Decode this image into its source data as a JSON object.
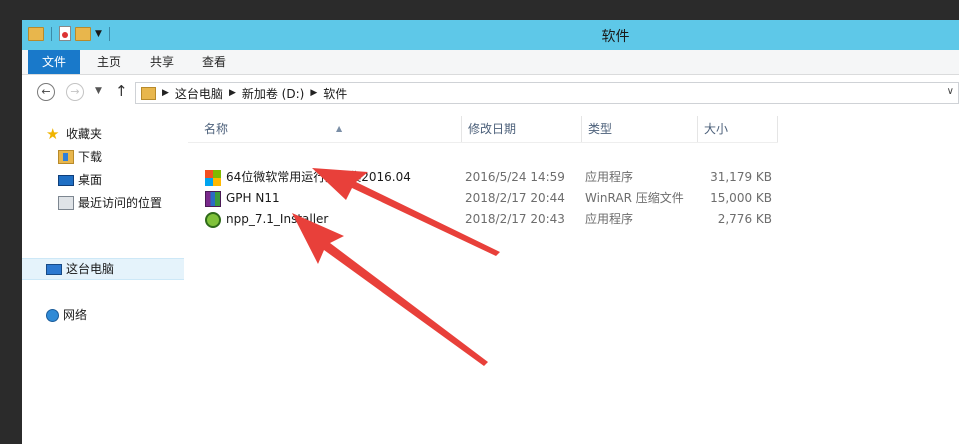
{
  "window": {
    "title": "软件"
  },
  "ribbon": {
    "tabs": [
      {
        "label": "文件"
      },
      {
        "label": "主页"
      },
      {
        "label": "共享"
      },
      {
        "label": "查看"
      }
    ]
  },
  "address": {
    "crumbs": [
      "这台电脑",
      "新加卷 (D:)",
      "软件"
    ]
  },
  "nav_pane": {
    "favorites": "收藏夹",
    "downloads": "下载",
    "desktop": "桌面",
    "recent": "最近访问的位置",
    "this_pc": "这台电脑",
    "network": "网络"
  },
  "columns": {
    "name": "名称",
    "date": "修改日期",
    "type": "类型",
    "size": "大小"
  },
  "files": [
    {
      "name": "64位微软常用运行库合集2016.04",
      "date": "2016/5/24 14:59",
      "type": "应用程序",
      "size": "31,179 KB",
      "icon": "windows-installer-icon"
    },
    {
      "name": "GPH N11",
      "date": "2018/2/17 20:44",
      "type": "WinRAR 压缩文件",
      "size": "15,000 KB",
      "icon": "winrar-archive-icon"
    },
    {
      "name": "npp_7.1_Installer",
      "date": "2018/2/17 20:43",
      "type": "应用程序",
      "size": "2,776 KB",
      "icon": "notepad-plus-plus-icon"
    }
  ],
  "colors": {
    "title_bar": "#5ec8e8",
    "file_tab": "#1979ca",
    "selection": "#e5f3fb",
    "annotation_arrow": "#e8403a"
  }
}
